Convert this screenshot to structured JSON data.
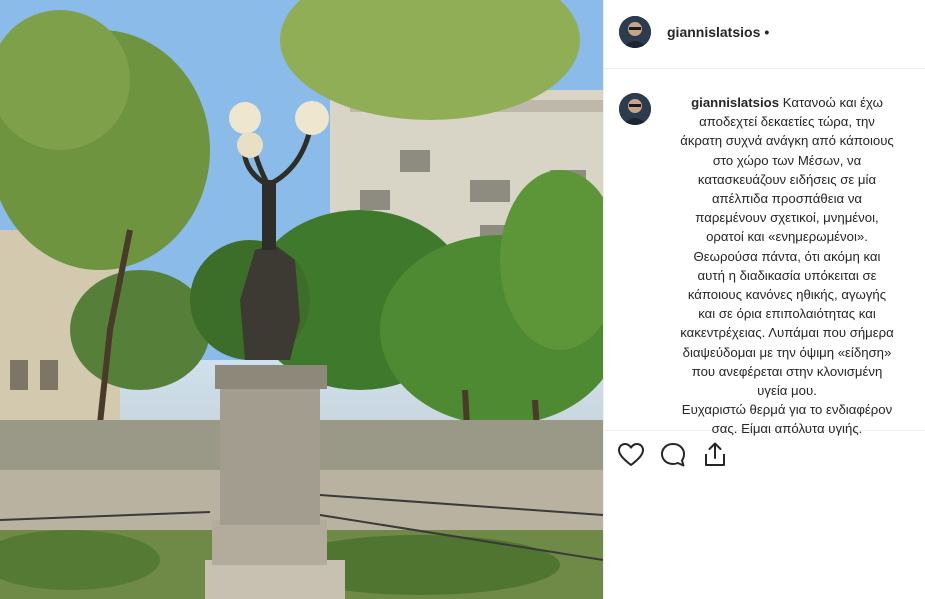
{
  "post": {
    "username": "giannislatsios",
    "header_separator": "•",
    "caption_lines": [
      "Κατανοώ και έχω",
      "αποδεχτεί δεκαετίες τώρα, την",
      "άκρατη συχνά ανάγκη από κάποιους",
      "στο χώρο των Μέσων, να",
      "κατασκευάζουν ειδήσεις σε μία",
      "απέλπιδα προσπάθεια να",
      "παρεμένουν σχετικοί, μνημένοι,",
      "ορατοί και «ενημερωμένοι».",
      "Θεωρούσα πάντα, ότι ακόμη και",
      "αυτή η διαδικασία υπόκειται σε",
      "κάποιους κανόνες ηθικής, αγωγής",
      "και σε όρια επιπολαιότητας και",
      "κακεντρέχειας. Λυπάμαι που σήμερα",
      "διαψεύδομαι με την όψιμη «είδηση»",
      "που ανεφέρεται στην κλονισμένη",
      "υγεία μου.",
      "Ευχαριστώ θερμά για το ενδιαφέρον",
      "σας. Είμαι απόλυτα υγιής."
    ]
  },
  "icons": {
    "like": "heart-icon",
    "comment": "comment-bubble-icon",
    "share": "share-icon"
  },
  "colors": {
    "text": "#262626",
    "border": "#efefef"
  }
}
